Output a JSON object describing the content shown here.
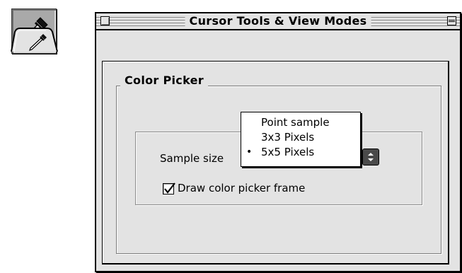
{
  "window": {
    "title": "Cursor Tools & View Modes"
  },
  "tool_button": {
    "icon": "eyedropper-icon"
  },
  "tabs": [
    {
      "icon": "eyedropper-icon",
      "selected": true
    }
  ],
  "group": {
    "title": "Color Picker"
  },
  "sample_size": {
    "label": "Sample size",
    "selected": "5x5 Pixels",
    "options": [
      {
        "label": "Point sample",
        "checked": false
      },
      {
        "label": "3x3 Pixels",
        "checked": false
      },
      {
        "label": "5x5 Pixels",
        "checked": true
      }
    ],
    "check_mark": "•"
  },
  "draw_frame": {
    "label": "Draw color picker frame",
    "checked": true
  },
  "colors": {
    "window_bg": "#e3e3e3",
    "tool_bg": "#a9a9a9",
    "menu_bg": "#ffffff"
  }
}
